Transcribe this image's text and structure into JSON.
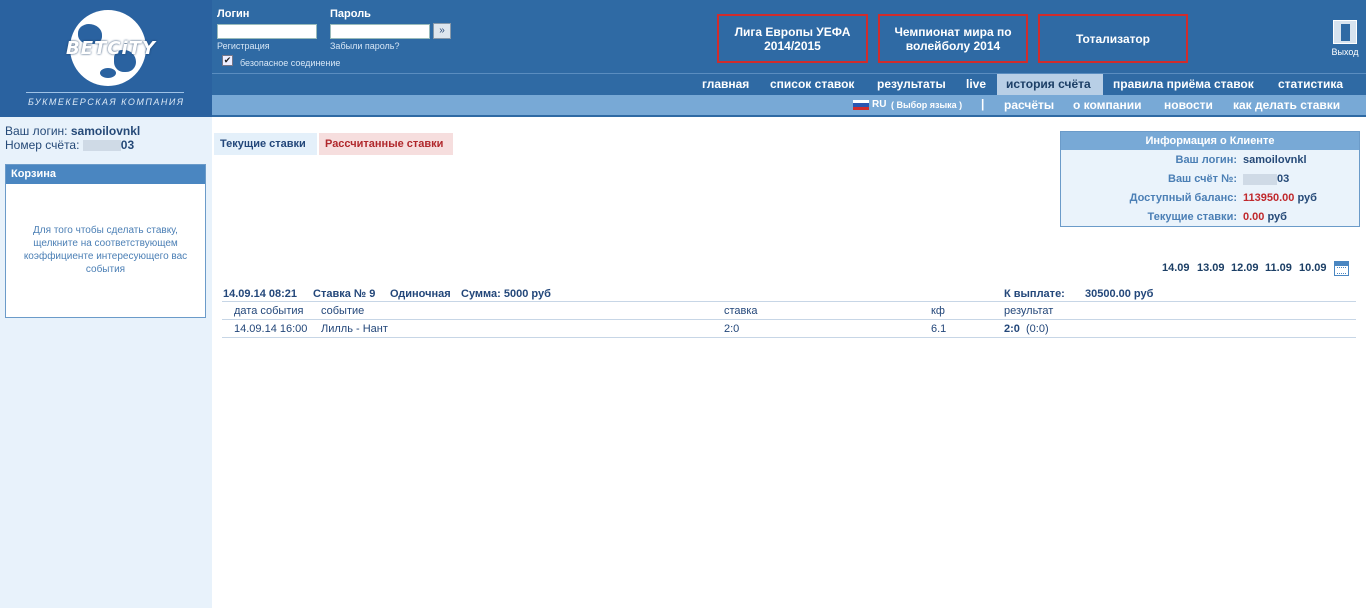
{
  "logo": {
    "brand": "BETCiTY",
    "tagline": "БУКМЕКЕРСКАЯ КОМПАНИЯ"
  },
  "login_form": {
    "login_label": "Логин",
    "password_label": "Пароль",
    "register_link": "Регистрация",
    "forgot_link": "Забыли пароль?",
    "go_button": "»",
    "secure_label": "безопасное соединение",
    "secure_checked": true
  },
  "promos": [
    {
      "label": "Лига Европы УЕФА 2014/2015"
    },
    {
      "label": "Чемпионат мира по волейболу 2014"
    },
    {
      "label": "Тотализатор"
    }
  ],
  "exit": {
    "label": "Выход"
  },
  "nav_main": [
    {
      "label": "главная"
    },
    {
      "label": "список ставок"
    },
    {
      "label": "результаты"
    },
    {
      "label": "live"
    },
    {
      "label": "история счёта",
      "active": true
    },
    {
      "label": "правила приёма ставок"
    },
    {
      "label": "статистика"
    }
  ],
  "nav_sub": {
    "language": "RU",
    "language_hint": "( Выбор языка )",
    "separator": "|",
    "items": [
      {
        "label": "расчёты"
      },
      {
        "label": "о компании"
      },
      {
        "label": "новости"
      },
      {
        "label": "как делать ставки"
      }
    ]
  },
  "sidebar": {
    "login_label": "Ваш логин:",
    "login_value": "samoilovnkl",
    "account_label": "Номер счёта:",
    "account_suffix": "03",
    "cart_title": "Корзина",
    "cart_text": "Для того чтобы сделать ставку, щелкните на соответствующем коэффициенте интересующего вас события"
  },
  "tabs": {
    "current": "Текущие ставки",
    "calculated": "Рассчитанные ставки"
  },
  "client_info": {
    "title": "Информация о Клиенте",
    "login_label": "Ваш логин:",
    "login_value": "samoilovnkl",
    "account_label": "Ваш счёт №:",
    "account_suffix": "03",
    "balance_label": "Доступный баланс:",
    "balance_value": "113950.00",
    "balance_currency": "руб",
    "current_bets_label": "Текущие ставки:",
    "current_bets_value": "0.00",
    "current_bets_currency": "руб"
  },
  "dates": {
    "active": "14.09",
    "others": [
      "13.09",
      "12.09",
      "11.09",
      "10.09"
    ]
  },
  "bet": {
    "datetime": "14.09.14 08:21",
    "number": "Ставка № 9",
    "type": "Одиночная",
    "amount": "Сумма: 5000 руб",
    "payout_label": "К выплате:",
    "payout_value": "30500.00 руб",
    "columns": [
      "дата события",
      "событие",
      "ставка",
      "кф",
      "результат"
    ],
    "rows": [
      {
        "date": "14.09.14 16:00",
        "event": "Лилль - Нант",
        "stake": "2:0",
        "coef": "6.1",
        "result": "2:0",
        "result_detail": "(0:0)"
      }
    ]
  }
}
